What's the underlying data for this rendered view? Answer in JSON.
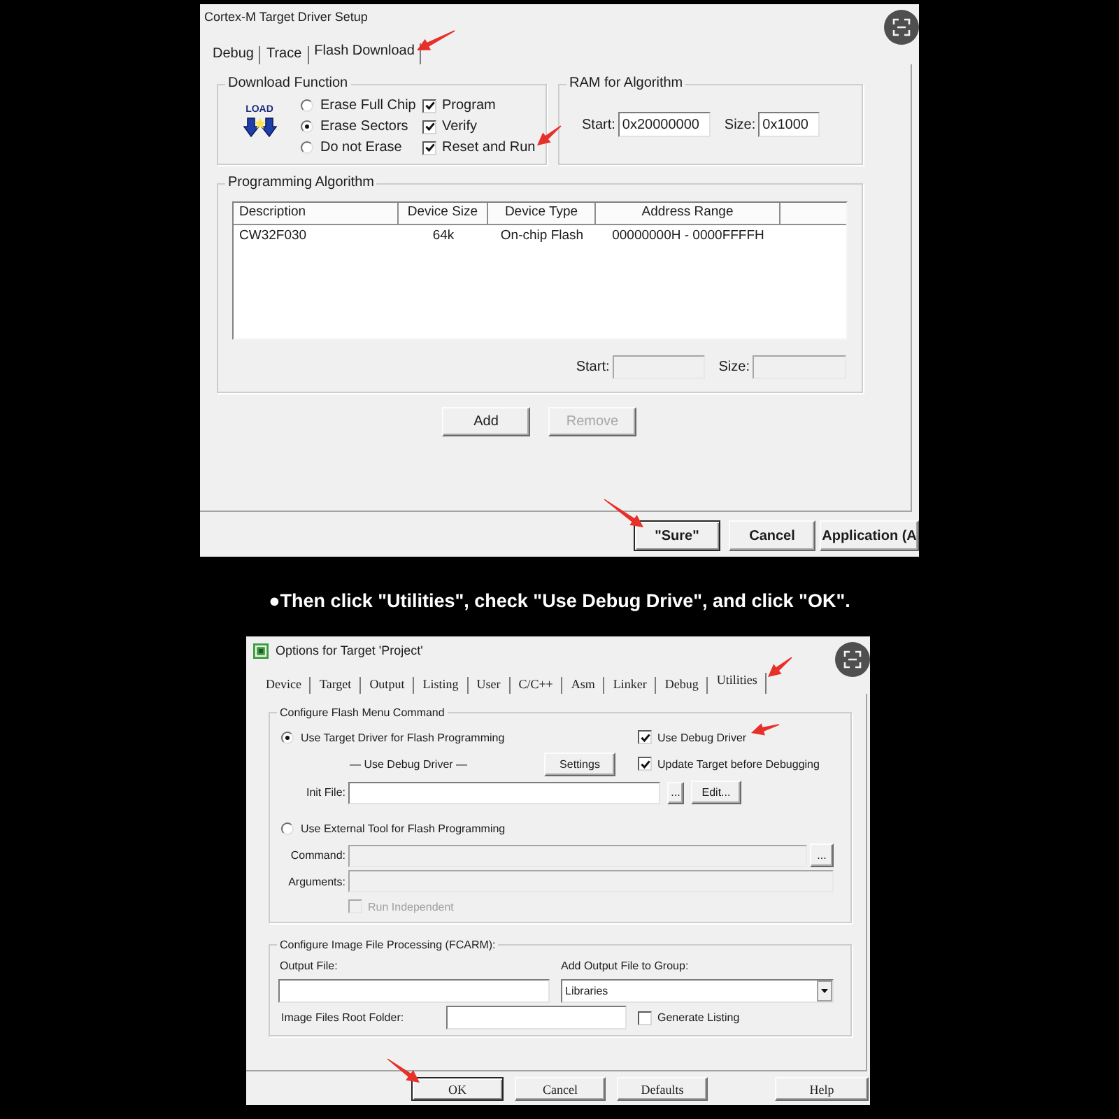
{
  "driver_setup": {
    "title": "Cortex-M Target Driver Setup",
    "tabs": [
      {
        "label": "Debug",
        "selected": false
      },
      {
        "label": "Trace",
        "selected": false
      },
      {
        "label": "Flash Download",
        "selected": true
      }
    ],
    "download_function": {
      "title": "Download Function",
      "icon_caption": "LOAD",
      "erase_options": [
        {
          "label": "Erase Full Chip",
          "selected": false
        },
        {
          "label": "Erase Sectors",
          "selected": true
        },
        {
          "label": "Do not Erase",
          "selected": false
        }
      ],
      "actions": [
        {
          "label": "Program",
          "checked": true
        },
        {
          "label": "Verify",
          "checked": true
        },
        {
          "label": "Reset and Run",
          "checked": true
        }
      ]
    },
    "ram_for_algorithm": {
      "title": "RAM for Algorithm",
      "fields": [
        {
          "label": "Start:",
          "value": "0x20000000",
          "disabled": false
        },
        {
          "label": "Size:",
          "value": "0x1000",
          "disabled": false
        }
      ]
    },
    "programming_algorithm": {
      "title": "Programming Algorithm",
      "columns": [
        "Description",
        "Device Size",
        "Device Type",
        "Address Range"
      ],
      "rows": [
        [
          "CW32F030",
          "64k",
          "On-chip Flash",
          "00000000H - 0000FFFFH"
        ]
      ],
      "fields": [
        {
          "label": "Start:",
          "disabled": true
        },
        {
          "label": "Size:",
          "disabled": true
        }
      ]
    },
    "buttons": [
      {
        "label": "Add",
        "disabled": false
      },
      {
        "label": "Remove",
        "disabled": true
      }
    ],
    "footer_buttons": [
      {
        "label": "\"Sure\"",
        "default": true
      },
      {
        "label": "Cancel",
        "default": false
      },
      {
        "label": "Application (A",
        "default": false
      }
    ]
  },
  "instruction": "●Then click \"Utilities\", check \"Use Debug Drive\", and click \"OK\".",
  "target_options": {
    "title": "Options for Target 'Project'",
    "tabs": [
      {
        "label": "Device",
        "selected": false
      },
      {
        "label": "Target",
        "selected": false
      },
      {
        "label": "Output",
        "selected": false
      },
      {
        "label": "Listing",
        "selected": false
      },
      {
        "label": "User",
        "selected": false
      },
      {
        "label": "C/C++",
        "selected": false
      },
      {
        "label": "Asm",
        "selected": false
      },
      {
        "label": "Linker",
        "selected": false
      },
      {
        "label": "Debug",
        "selected": false
      },
      {
        "label": "Utilities",
        "selected": true
      }
    ],
    "flash_menu": {
      "title": "Configure Flash Menu Command",
      "modes": [
        {
          "label": "Use Target Driver for Flash Programming",
          "selected": true
        },
        {
          "label": "Use External Tool for Flash Programming",
          "selected": false
        }
      ],
      "use_debug_driver": {
        "label": "Use Debug Driver",
        "checked": true
      },
      "driver_caption": "— Use Debug Driver —",
      "settings_button": "Settings",
      "update_target": {
        "label": "Update Target before Debugging",
        "checked": true
      },
      "init_file": {
        "label": "Init File:",
        "disabled": false,
        "browse_button": "...",
        "edit_button": "Edit..."
      },
      "command": {
        "label": "Command:",
        "disabled": true,
        "browse_button": "..."
      },
      "arguments": {
        "label": "Arguments:",
        "disabled": true
      },
      "run_independent": {
        "label": "Run Independent",
        "checked": false,
        "disabled": true
      }
    },
    "image_processing": {
      "title": "Configure Image File Processing (FCARM):",
      "output_file": {
        "label": "Output File:"
      },
      "group": {
        "label": "Add Output File to Group:",
        "value": "Libraries"
      },
      "root_folder": {
        "label": "Image Files Root Folder:"
      },
      "generate_listing": {
        "label": "Generate Listing",
        "checked": false
      }
    },
    "footer_buttons": [
      {
        "label": "OK",
        "default": true
      },
      {
        "label": "Cancel",
        "default": false
      },
      {
        "label": "Defaults",
        "default": false
      },
      {
        "label": "Help",
        "default": false
      }
    ]
  }
}
